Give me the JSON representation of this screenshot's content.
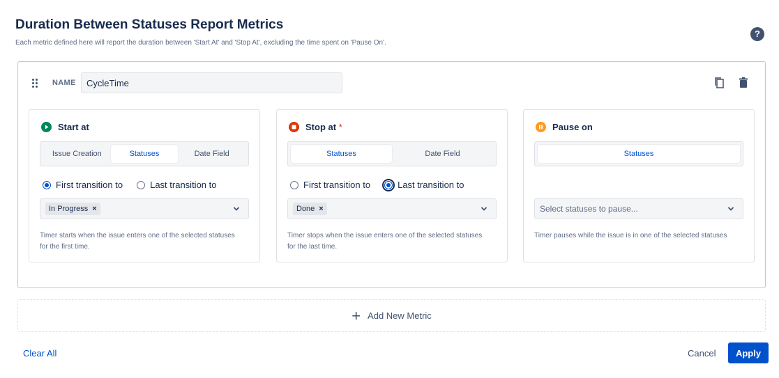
{
  "header": {
    "title": "Duration Between Statuses Report Metrics",
    "subtitle": "Each metric defined here will report the duration between 'Start At' and 'Stop At', excluding the time spent on 'Pause On'.",
    "help_icon": "question-circle-icon",
    "help_glyph": "?"
  },
  "metric": {
    "name_label": "NAME",
    "name_value": "CycleTime",
    "actions": [
      "copy-icon",
      "trash-icon"
    ]
  },
  "start_at": {
    "title": "Start at",
    "icon_color": "#00875a",
    "tabs": [
      "Issue Creation",
      "Statuses",
      "Date Field"
    ],
    "active_tab": "Statuses",
    "radio_first": "First transition to",
    "radio_last": "Last transition to",
    "selected_radio": "first",
    "chip": "In Progress",
    "helper": "Timer starts when the issue enters one of the selected statuses for the first time."
  },
  "stop_at": {
    "title": "Stop at",
    "required_marker": "*",
    "icon_color": "#de350b",
    "tabs": [
      "Statuses",
      "Date Field"
    ],
    "active_tab": "Statuses",
    "radio_first": "First transition to",
    "radio_last": "Last transition to",
    "selected_radio": "last",
    "chip": "Done",
    "helper": "Timer stops when the issue enters one of the selected statuses for the last time."
  },
  "pause_on": {
    "title": "Pause on",
    "icon_color": "#ff991f",
    "tabs": [
      "Statuses"
    ],
    "active_tab": "Statuses",
    "placeholder": "Select statuses to pause...",
    "helper": "Timer pauses while the issue is in one of the selected statuses"
  },
  "add_metric": {
    "label": "Add New Metric",
    "icon": "plus-icon"
  },
  "footer": {
    "clear_all": "Clear All",
    "cancel": "Cancel",
    "apply": "Apply"
  },
  "colors": {
    "primary": "#0052cc",
    "text": "#172b4d",
    "muted": "#5e6c84"
  }
}
